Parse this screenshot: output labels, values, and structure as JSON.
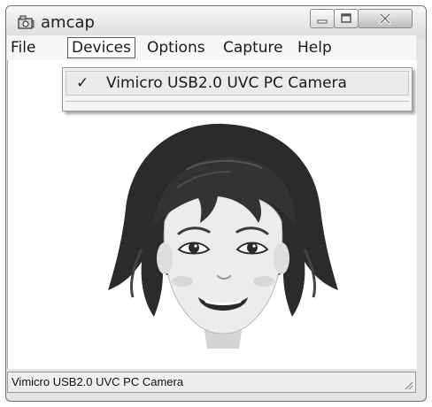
{
  "window": {
    "title": "amcap"
  },
  "menubar": {
    "items": [
      "File",
      "Devices",
      "Options",
      "Capture",
      "Help"
    ],
    "open_menu": "Devices"
  },
  "devices_menu": {
    "items": [
      {
        "label": "Vimicro USB2.0 UVC PC Camera",
        "checked": true,
        "check_glyph": "✓"
      }
    ]
  },
  "preview": {
    "image": "cartoon-woman-face-icon"
  },
  "statusbar": {
    "text": "Vimicro USB2.0 UVC PC Camera"
  },
  "colors": {
    "window_frame": "#e4e4e4",
    "client_bg": "#ffffff",
    "hair": "#2a2a2a",
    "skin": "#e6e6e6"
  }
}
